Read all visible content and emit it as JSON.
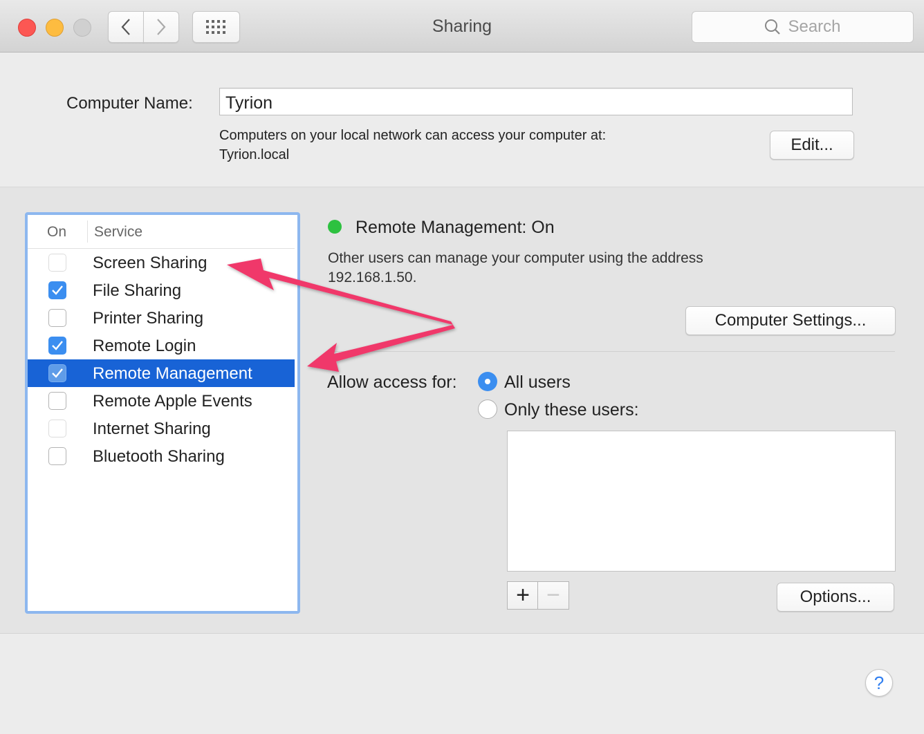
{
  "window": {
    "title": "Sharing",
    "search_placeholder": "Search",
    "icons": {
      "close": "red-close-icon",
      "minimize": "yellow-minimize-icon",
      "zoom": "gray-zoom-icon",
      "back": "chevron-left-icon",
      "forward": "chevron-right-icon",
      "show_all": "grid-icon",
      "search": "magnifier-icon"
    }
  },
  "computer_name": {
    "label": "Computer Name:",
    "value": "Tyrion",
    "info_line1": "Computers on your local network can access your computer at:",
    "info_line2": "Tyrion.local",
    "edit_button": "Edit..."
  },
  "services": {
    "header_on": "On",
    "header_service": "Service",
    "items": [
      {
        "name": "Screen Sharing",
        "checked": false,
        "enabled": false
      },
      {
        "name": "File Sharing",
        "checked": true,
        "enabled": true
      },
      {
        "name": "Printer Sharing",
        "checked": false,
        "enabled": true
      },
      {
        "name": "Remote Login",
        "checked": true,
        "enabled": true
      },
      {
        "name": "Remote Management",
        "checked": true,
        "enabled": true,
        "selected": true
      },
      {
        "name": "Remote Apple Events",
        "checked": false,
        "enabled": true
      },
      {
        "name": "Internet Sharing",
        "checked": false,
        "enabled": false
      },
      {
        "name": "Bluetooth Sharing",
        "checked": false,
        "enabled": true
      }
    ]
  },
  "detail": {
    "status_title": "Remote Management: On",
    "status_color": "#2dc140",
    "desc_line1": "Other users can manage your computer using the address",
    "desc_line2": "192.168.1.50.",
    "computer_settings_button": "Computer Settings...",
    "allow_access_label": "Allow access for:",
    "radio_all_users": "All users",
    "radio_only_these": "Only these users:",
    "selected_radio": "All users",
    "add_button": "+",
    "remove_button": "−",
    "options_button": "Options..."
  },
  "help_button": "?",
  "annotation": {
    "type": "double-headed-arrow",
    "color": "#f0386b",
    "points_to": [
      "Screen Sharing",
      "Remote Management"
    ]
  }
}
